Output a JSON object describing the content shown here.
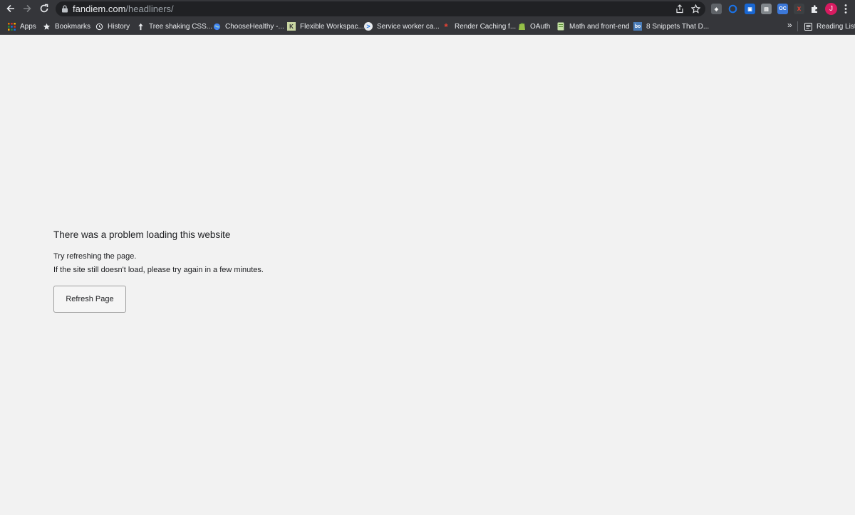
{
  "browser": {
    "url_host": "fandiem.com",
    "url_path": "/headliners/",
    "avatar_initial": "J",
    "extensions": [
      {
        "name": "shield-extension",
        "label": "",
        "color": "#5f6368"
      },
      {
        "name": "circle-extension",
        "label": "",
        "color": "#1a73e8"
      },
      {
        "name": "blue-extension",
        "label": "",
        "color": "#1967d2"
      },
      {
        "name": "window-extension",
        "label": "",
        "color": "#80868b"
      },
      {
        "name": "oc-extension",
        "label": "OC",
        "color": "#3c78d8"
      },
      {
        "name": "red-x-extension",
        "label": "x",
        "color": "#c5221f"
      }
    ]
  },
  "bookmarks": {
    "items": [
      {
        "label": "Apps",
        "icon": "apps-grid-icon"
      },
      {
        "label": "Bookmarks",
        "icon": "star-icon"
      },
      {
        "label": "History",
        "icon": "history-icon"
      },
      {
        "label": "Tree shaking CSS...",
        "icon": "pin-icon"
      },
      {
        "label": "ChooseHealthy -...",
        "icon": "globe-icon"
      },
      {
        "label": "Flexible Workspac...",
        "icon": "k-favicon-icon"
      },
      {
        "label": "Service worker ca...",
        "icon": "terminal-icon"
      },
      {
        "label": "Render Caching f...",
        "icon": "asterisk-icon"
      },
      {
        "label": "OAuth",
        "icon": "shopify-icon"
      },
      {
        "label": "Math and front-end",
        "icon": "notebook-icon"
      },
      {
        "label": "8 Snippets That D...",
        "icon": "bo-favicon-icon"
      }
    ],
    "overflow": "»",
    "reading_list": "Reading List"
  },
  "page": {
    "title": "There was a problem loading this website",
    "line1": "Try refreshing the page.",
    "line2": "If the site still doesn't load, please try again in a few minutes.",
    "button_label": "Refresh Page"
  }
}
